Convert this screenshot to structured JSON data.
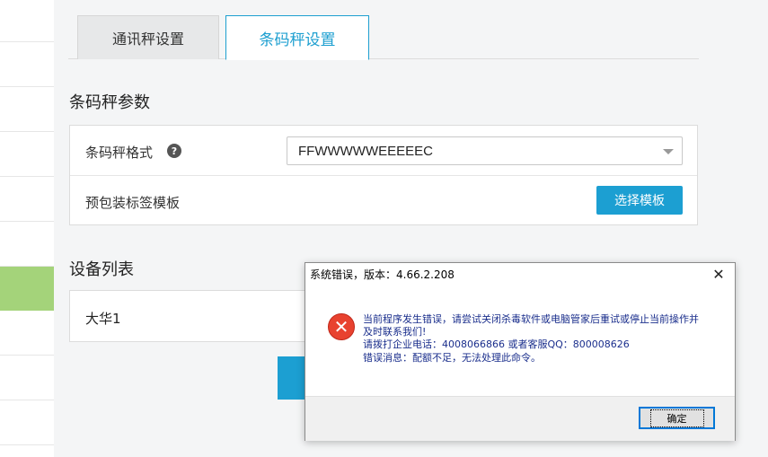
{
  "tabs": {
    "comm": "通讯秤设置",
    "barcode": "条码秤设置"
  },
  "params": {
    "title": "条码秤参数",
    "format_label": "条码秤格式",
    "format_value": "FFWWWWWEEEEEC",
    "template_label": "预包装标签模板",
    "choose_template_button": "选择模板"
  },
  "devices": {
    "title": "设备列表",
    "items": [
      "大华1"
    ]
  },
  "error_dialog": {
    "title": "系统错误，版本：4.66.2.208",
    "message_line1": "当前程序发生错误，请尝试关闭杀毒软件或电脑管家后重试或停止当前操作并",
    "message_line2": "及时联系我们!",
    "message_line3": "请拨打企业电话：4008066866 或者客服QQ：800008626",
    "message_line4": "错误消息：配额不足，无法处理此命令。",
    "ok_button": "确定"
  },
  "colors": {
    "accent": "#1c9fd2",
    "sidebar_active": "#a4d37a",
    "error_red": "#e8422f"
  },
  "icons": {
    "help": "question-circle-icon",
    "close": "close-icon",
    "error": "error-x-icon",
    "dropdown": "chevron-down-icon"
  }
}
